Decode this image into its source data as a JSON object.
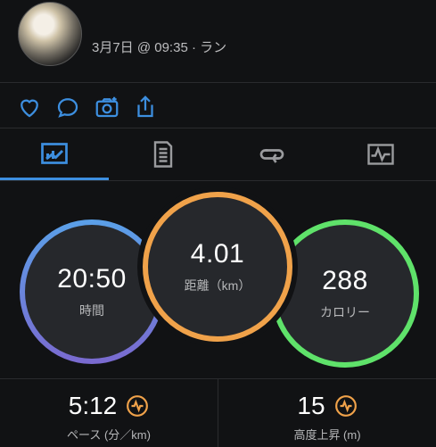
{
  "header": {
    "subtitle": "3月7日 @ 09:35 · ラン"
  },
  "actions": [
    {
      "name": "heart-icon"
    },
    {
      "name": "comment-icon"
    },
    {
      "name": "add-photo-icon"
    },
    {
      "name": "share-icon"
    }
  ],
  "tabs": [
    {
      "name": "tab-summary",
      "icon": "stats-chart-icon",
      "active": true
    },
    {
      "name": "tab-details",
      "icon": "document-list-icon",
      "active": false
    },
    {
      "name": "tab-laps",
      "icon": "loop-arrows-icon",
      "active": false
    },
    {
      "name": "tab-charts",
      "icon": "waveform-chart-icon",
      "active": false
    }
  ],
  "metrics": {
    "time": {
      "value": "20:50",
      "label": "時間"
    },
    "distance": {
      "value": "4.01",
      "label": "距離（km）"
    },
    "calories": {
      "value": "288",
      "label": "カロリー"
    }
  },
  "stats": {
    "pace": {
      "value": "5:12",
      "label": "ペース (分／km)",
      "icon": "pulse-badge-icon"
    },
    "elevation": {
      "value": "15",
      "label": "高度上昇 (m)",
      "icon": "pulse-badge-icon"
    }
  },
  "colors": {
    "accent_blue": "#3d8fe0",
    "ring_blue": "#5aa0e8",
    "ring_purple": "#7a6ad0",
    "ring_orange": "#f0a24a",
    "ring_green": "#5fe26a",
    "badge_orange": "#f0a24a"
  }
}
